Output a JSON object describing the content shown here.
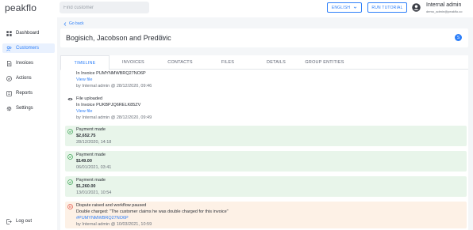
{
  "app": {
    "logo": "peakflo"
  },
  "search": {
    "placeholder": "Find customer"
  },
  "header": {
    "language_label": "ENGLISH",
    "tutorial_label": "RUN TUTORIAL",
    "user_name": "Internal admin",
    "user_email": "demo_admin@peakflo.co"
  },
  "sidebar": {
    "items": [
      {
        "label": "Dashboard",
        "icon": "grid-icon"
      },
      {
        "label": "Customers",
        "icon": "users-icon"
      },
      {
        "label": "Invoices",
        "icon": "file-icon"
      },
      {
        "label": "Actions",
        "icon": "check-circle-icon"
      },
      {
        "label": "Reports",
        "icon": "report-icon"
      },
      {
        "label": "Settings",
        "icon": "gear-icon"
      }
    ],
    "logout_label": "Log out"
  },
  "customer": {
    "back_label": "Go back",
    "name": "Bogisich, Jacobson and Predovic",
    "badge": "S"
  },
  "tabs": [
    "TIMELINE",
    "INVOICES",
    "CONTACTS",
    "FILES",
    "DETAILS",
    "GROUP ENTITIES"
  ],
  "timeline": {
    "e0": {
      "invoice": "In Invoice PUMYNMWBRQ27NO6P",
      "view": "View file",
      "by": "by Internal admin @ 28/12/2020, 09:46"
    },
    "e1": {
      "title": "File uploaded",
      "invoice": "In Invoice PUKBPJQ6RELK85ZV",
      "view": "View file",
      "by": "by Internal admin @ 28/12/2020, 09:49"
    },
    "e2": {
      "title": "Payment made",
      "amount": "$2,652.75",
      "date": "28/12/2020, 14:18"
    },
    "e3": {
      "title": "Payment made",
      "amount": "$149.00",
      "date": "06/01/2021, 03:41"
    },
    "e4": {
      "title": "Payment made",
      "amount": "$1,260.00",
      "date": "13/01/2021, 10:54"
    },
    "e5": {
      "title": "Dispute raised and workflow paused",
      "detail": "Double charged: \"The customer claims he was double charged for this invoice\"",
      "invoice": "#PUMYNMWBRQ27NO6P",
      "by": "by Internal admin @ 10/03/2021, 10:59"
    }
  },
  "colors": {
    "accent": "#2d7ff9",
    "success_bg": "#e8f5ea",
    "dispute_bg": "#fdf1e6"
  }
}
